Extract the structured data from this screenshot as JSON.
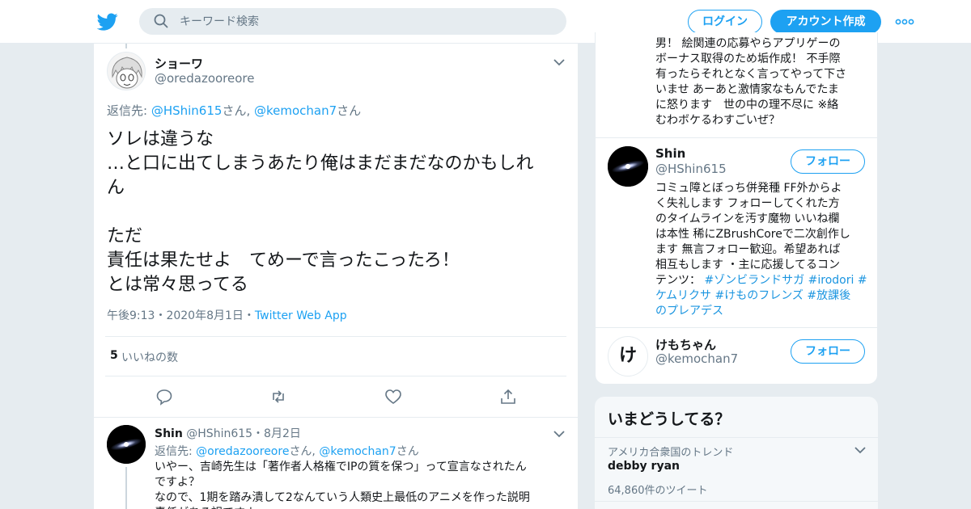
{
  "header": {
    "search_placeholder": "キーワード検索",
    "login_label": "ログイン",
    "signup_label": "アカウント作成",
    "logo_icon": "twitter-bird-icon",
    "brand_color": "#1da1f2"
  },
  "tweet": {
    "display_name": "ショーワ",
    "handle": "@oredazooreore",
    "reply_prefix": "返信先: ",
    "reply_mention1": "@HShin615",
    "reply_sep": "さん, ",
    "reply_mention2": "@kemochan7",
    "reply_suffix": "さん",
    "text": "ソレは違うな\n…と口に出てしまうあたり俺はまだまだなのかもしれ\nん\n\nただ\n責任は果たせよ　てめーで言ったこったろ！\nとは常々思ってる",
    "time": "午後9:13・2020年8月1日・",
    "via": "Twitter Web App",
    "like_count": "5",
    "like_label": "いいねの数"
  },
  "reply": {
    "display_name": "Shin",
    "handle_date": "@HShin615・8月2日",
    "reply_prefix": "返信先: ",
    "reply_mention1": "@oredazooreore",
    "reply_sep": "さん, ",
    "reply_mention2": "@kemochan7",
    "reply_suffix": "さん",
    "text": "いやー、吉崎先生は「著作者人格権でIPの質を保つ」って宣言なされたん\nですよ？\nなので、1期を踏み潰して2なんていう人類史上最低のアニメを作った説明\n責任がある訳ですよ"
  },
  "follow_card": {
    "top_bio": "男！ 絵関連の応募やらアプリゲーの\nボーナス取得のため垢作成！ 不手際\n有ったらそれとなく言ってやって下さ\nいませ あーあと激情家なもんでたま\nに怒ります　世の中の理不尽に ※絡\nむわボケるわすごいぜ？",
    "users": [
      {
        "name": "Shin",
        "handle": "@HShin615",
        "follow_label": "フォロー",
        "bio_text": "コミュ障とぼっち併発種 FF外からよ\nく失礼します フォローしてくれた方\nのタイムラインを汚す魔物 いいね欄\nは本性 稀にZBrushCoreで二次創作し\nます 無言フォロー歓迎。希望あれば\n相互もします ・主に応援してるコン\nテンツ： ",
        "hashtags": [
          "#ゾンビランドサガ",
          "#irodori",
          "#",
          "ケムリクサ",
          "#けものフレンズ",
          "#放課後",
          "のプレアデス"
        ]
      },
      {
        "name": "けもちゃん",
        "handle": "@kemochan7",
        "follow_label": "フォロー",
        "avatar_text": "け"
      }
    ]
  },
  "trends": {
    "title": "いまどうしてる？",
    "items": [
      {
        "context": "アメリカ合衆国のトレンド",
        "name": "debby ryan",
        "count": "64,860件のツイート"
      }
    ]
  }
}
